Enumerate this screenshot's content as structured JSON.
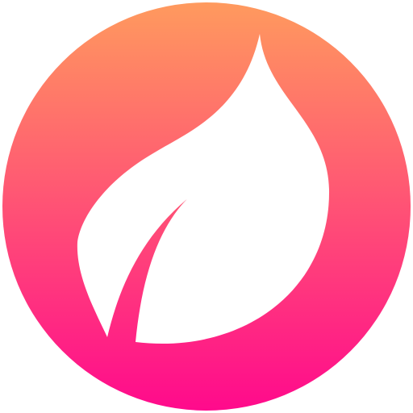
{
  "logo": {
    "icon": "leaf-icon",
    "colors": {
      "gradient_top": "#FF9A5E",
      "gradient_bottom": "#FF0A8C",
      "leaf": "#FFFFFF"
    }
  }
}
